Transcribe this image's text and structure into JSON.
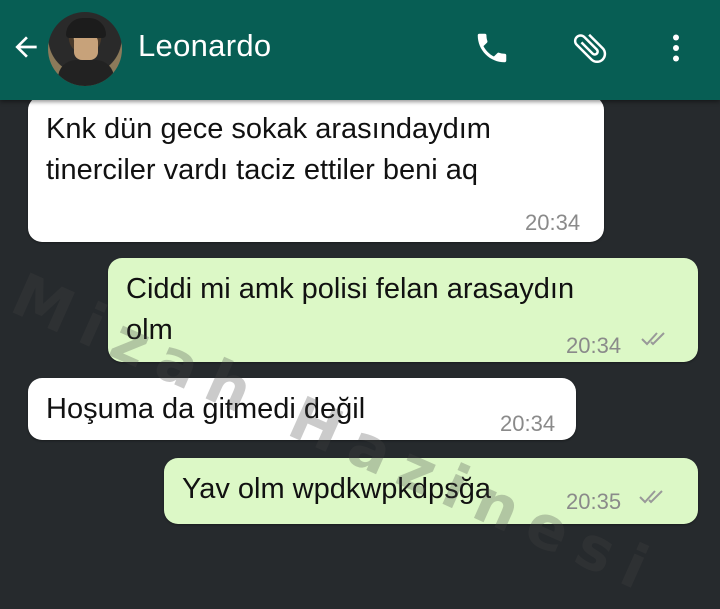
{
  "header": {
    "contact_name": "Leonardo",
    "back_icon": "arrow-left-icon",
    "call_icon": "phone-icon",
    "attach_icon": "paperclip-icon",
    "menu_icon": "more-vertical-icon",
    "bg_color": "#075e54"
  },
  "messages": [
    {
      "direction": "incoming",
      "lines": [
        "Knk dün gece sokak arasındaydım",
        "tinerciler vardı taciz ettiler beni aq"
      ],
      "time": "20:34"
    },
    {
      "direction": "outgoing",
      "lines": [
        "Ciddi mi amk polisi felan arasaydın",
        "olm"
      ],
      "time": "20:34",
      "status": "read"
    },
    {
      "direction": "incoming",
      "lines": [
        "Hoşuma da gitmedi değil"
      ],
      "time": "20:34"
    },
    {
      "direction": "outgoing",
      "lines": [
        "Yav olm wpdkwpkdpsğa"
      ],
      "time": "20:35",
      "status": "read"
    }
  ],
  "watermark": "Mizah Hazinesi",
  "colors": {
    "incoming": "#ffffff",
    "outgoing": "#dcf8c6",
    "chat_bg": "#262a2d"
  }
}
